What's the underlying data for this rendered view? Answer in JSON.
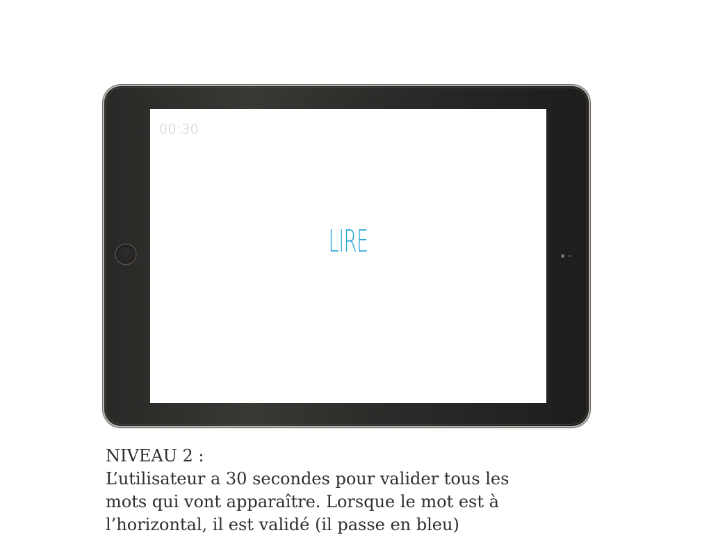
{
  "device": {
    "screen": {
      "timer": "00:30",
      "word": "LIRE",
      "word_color": "#2aa6d6"
    }
  },
  "caption": {
    "title": "NIVEAU 2 :",
    "line1": "L’utilisateur a 30 secondes pour valider tous les",
    "line2": "mots qui vont apparaître. Lorsque le mot est à",
    "line3": "l’horizontal, il est validé (il passe en bleu)"
  }
}
